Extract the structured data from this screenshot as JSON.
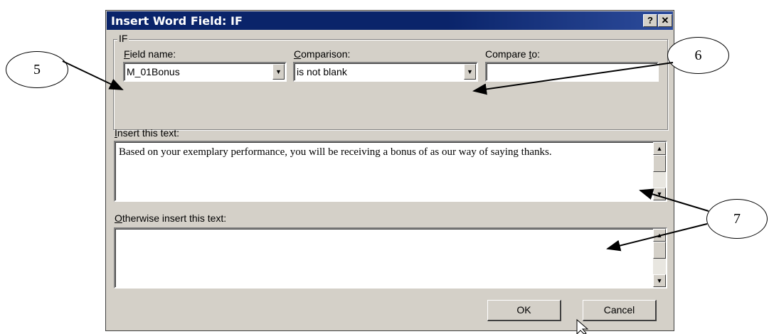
{
  "dialog": {
    "title": "Insert Word Field: IF",
    "help_glyph": "?",
    "close_glyph": "✕",
    "group_label": "IF",
    "field_name": {
      "label_u": "F",
      "label_rest": "ield name:",
      "value": "M_01Bonus"
    },
    "comparison": {
      "label_u": "C",
      "label_rest": "omparison:",
      "value": "is not blank"
    },
    "compare_to": {
      "label_pre": "Compare ",
      "label_u": "t",
      "label_rest": "o:",
      "value": ""
    },
    "insert_text": {
      "label_u": "I",
      "label_rest": "nsert this text:",
      "value": "Based on your exemplary performance, you will be receiving a bonus of  as our way of saying thanks."
    },
    "otherwise_text": {
      "label_u": "O",
      "label_rest": "therwise insert this text:",
      "value": ""
    },
    "ok_label": "OK",
    "cancel_label": "Cancel"
  },
  "callouts": [
    "5",
    "6",
    "7"
  ]
}
